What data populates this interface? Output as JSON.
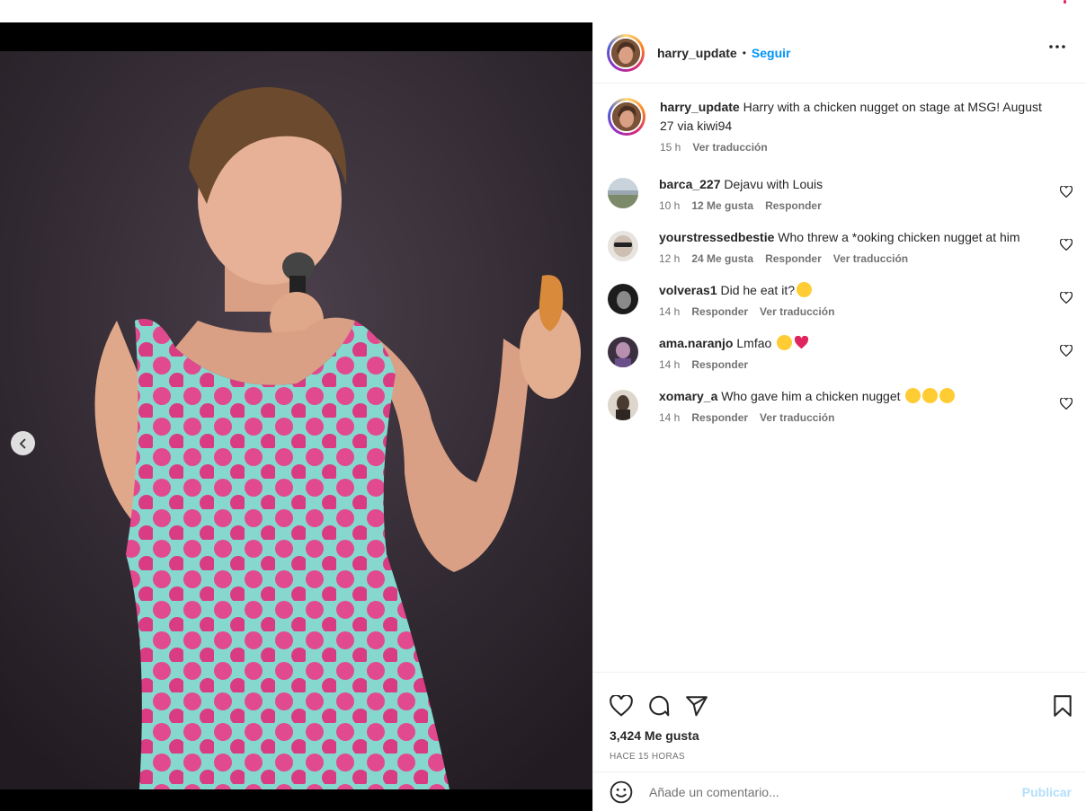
{
  "post": {
    "author": "harry_update",
    "separator": "•",
    "follow_label": "Seguir",
    "caption_text": "Harry with a chicken nugget on stage at MSG! August 27 via kiwi94",
    "caption_time": "15 h",
    "translate_label": "Ver traducción"
  },
  "comments": [
    {
      "user": "barca_227",
      "text": "Dejavu with Louis",
      "time": "10 h",
      "likes": "12 Me gusta",
      "reply": "Responder",
      "translate": ""
    },
    {
      "user": "yourstressedbestie",
      "text": "Who threw a *ooking chicken nugget at him",
      "time": "12 h",
      "likes": "24 Me gusta",
      "reply": "Responder",
      "translate": "Ver traducción"
    },
    {
      "user": "volveras1",
      "text": "Did he eat it?",
      "time": "14 h",
      "likes": "",
      "reply": "Responder",
      "translate": "Ver traducción"
    },
    {
      "user": "ama.naranjo",
      "text": "Lmfao",
      "time": "14 h",
      "likes": "",
      "reply": "Responder",
      "translate": ""
    },
    {
      "user": "xomary_a",
      "text": "Who gave him a chicken nugget",
      "time": "14 h",
      "likes": "",
      "reply": "Responder",
      "translate": "Ver traducción"
    }
  ],
  "footer": {
    "likes_count": "3,424 Me gusta",
    "posted_ago": "HACE 15 HORAS",
    "comment_placeholder": "Añade un comentario...",
    "publish_label": "Publicar"
  },
  "icons": [
    "more-icon",
    "heart-icon",
    "comment-icon",
    "share-icon",
    "save-icon",
    "emoji-icon",
    "chevron-left-icon"
  ],
  "colors": {
    "link_blue": "#0095f6",
    "publish_disabled": "#b2dffc",
    "dress_teal": "#7fd6cf",
    "dress_pink": "#e0458f"
  }
}
